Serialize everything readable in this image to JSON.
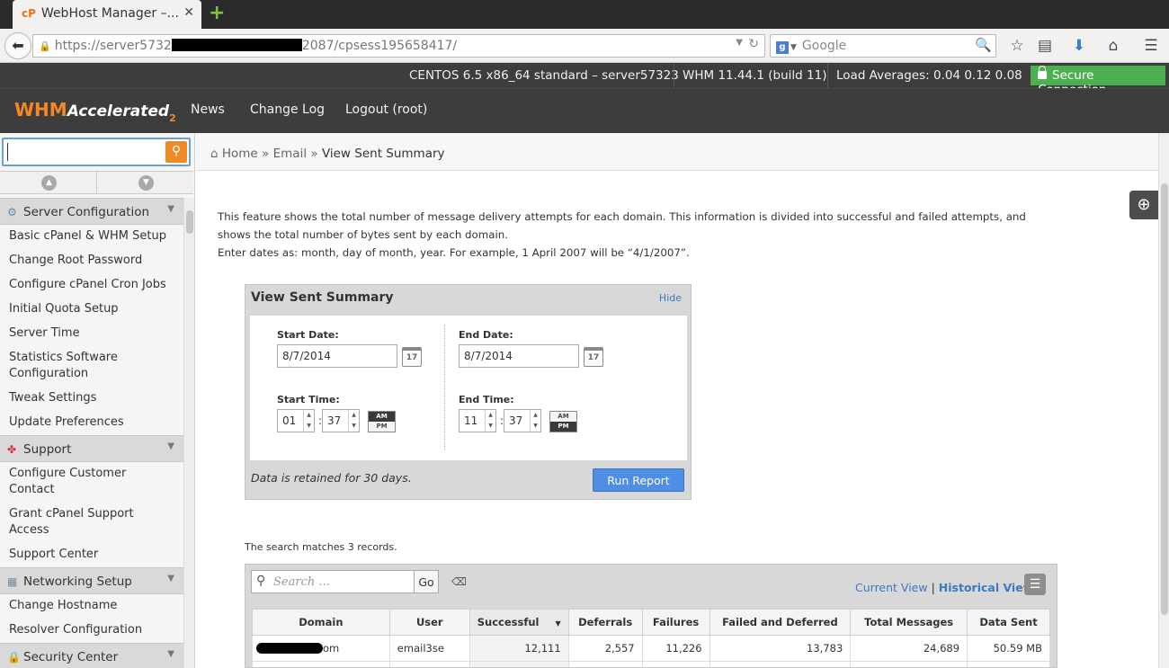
{
  "browser": {
    "tab_title": "WebHost Manager –...",
    "tab_favicon": "cP",
    "url_prefix": "https://server5732",
    "url_suffix": "2087/cpsess195658417/",
    "search_placeholder": "Google"
  },
  "statusbar": {
    "os": "CENTOS 6.5 x86_64 standard – server57323",
    "version": "WHM 11.44.1 (build 11)",
    "load": "Load Averages: 0.04 0.12 0.08",
    "secure": "Secure Connection"
  },
  "header": {
    "logo_whm": "WHM",
    "logo_accel": "Accelerated",
    "logo_num": "2",
    "nav": [
      "News",
      "Change Log",
      "Logout (root)"
    ]
  },
  "sidebar": {
    "sections": [
      {
        "title": "Server Configuration",
        "icon": "gear-icon",
        "items": [
          "Basic cPanel & WHM Setup",
          "Change Root Password",
          "Configure cPanel Cron Jobs",
          "Initial Quota Setup",
          "Server Time",
          "Statistics Software Configuration",
          "Tweak Settings",
          "Update Preferences"
        ]
      },
      {
        "title": "Support",
        "icon": "support-icon",
        "items": [
          "Configure Customer Contact",
          "Grant cPanel Support Access",
          "Support Center"
        ]
      },
      {
        "title": "Networking Setup",
        "icon": "network-icon",
        "items": [
          "Change Hostname",
          "Resolver Configuration"
        ]
      },
      {
        "title": "Security Center",
        "icon": "lock-icon",
        "items": []
      }
    ]
  },
  "breadcrumb": {
    "home": "Home",
    "sep": "»",
    "email": "Email",
    "current": "View Sent Summary"
  },
  "intro": {
    "line1": "This feature shows the total number of message delivery attempts for each domain. This information is divided into successful and failed attempts, and shows the total number of bytes sent by each domain.",
    "line2": "Enter dates as: month, day of month, year. For example, 1 April 2007 will be “4/1/2007”."
  },
  "form": {
    "title": "View Sent Summary",
    "hide": "Hide",
    "start_date_label": "Start Date:",
    "start_date": "8/7/2014",
    "end_date_label": "End Date:",
    "end_date": "8/7/2014",
    "start_time_label": "Start Time:",
    "start_hour": "01",
    "start_min": "37",
    "start_ampm": "AM",
    "end_time_label": "End Time:",
    "end_hour": "11",
    "end_min": "37",
    "end_ampm": "PM",
    "am": "AM",
    "pm": "PM",
    "cal_day": "17",
    "retain": "Data is retained for 30 days.",
    "run": "Run Report"
  },
  "results": {
    "match": "The search matches 3 records.",
    "search_placeholder": "Search ...",
    "go": "Go",
    "current_view": "Current View",
    "separator": "|",
    "historical_view": "Historical View",
    "columns": [
      "Domain",
      "User",
      "Successful",
      "Deferrals",
      "Failures",
      "Failed and Deferred",
      "Total Messages",
      "Data Sent"
    ],
    "rows": [
      {
        "domain": "om",
        "user": "email3se",
        "successful": "12,111",
        "deferrals": "2,557",
        "failures": "11,226",
        "failed_deferred": "13,783",
        "total": "24,689",
        "data_sent": "50.59 MB"
      }
    ]
  }
}
